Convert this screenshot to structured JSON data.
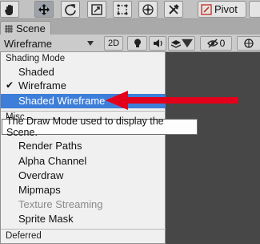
{
  "toolbar": {
    "tools": [
      "hand-tool-icon",
      "move-tool-icon",
      "rotate-tool-icon",
      "scale-tool-icon",
      "rect-tool-icon",
      "transform-tool-icon",
      "custom-tool-icon"
    ],
    "pivot_label": "Pivot"
  },
  "scene_tab": {
    "label": "Scene"
  },
  "scene_bar": {
    "draw_mode": "Wireframe",
    "mode_2d": "2D",
    "gizmo_count": "0"
  },
  "menu": {
    "shading_header": "Shading Mode",
    "items": [
      {
        "label": "Shaded"
      },
      {
        "label": "Wireframe",
        "checked": true
      },
      {
        "label": "Shaded Wireframe",
        "selected": true
      }
    ],
    "partial_header": "Misc",
    "misc_items": [
      {
        "label": "Render Paths"
      },
      {
        "label": "Alpha Channel"
      },
      {
        "label": "Overdraw"
      },
      {
        "label": "Mipmaps"
      },
      {
        "label": "Texture Streaming",
        "disabled": true
      },
      {
        "label": "Sprite Mask"
      }
    ],
    "deferred_header": "Deferred"
  },
  "tooltip": {
    "text": "The Draw Mode used to display the Scene."
  },
  "colors": {
    "selection": "#3d7ed9",
    "arrow": "#e3001b",
    "menu_bg": "#f0f0f0",
    "viewport_bg": "#474747"
  }
}
